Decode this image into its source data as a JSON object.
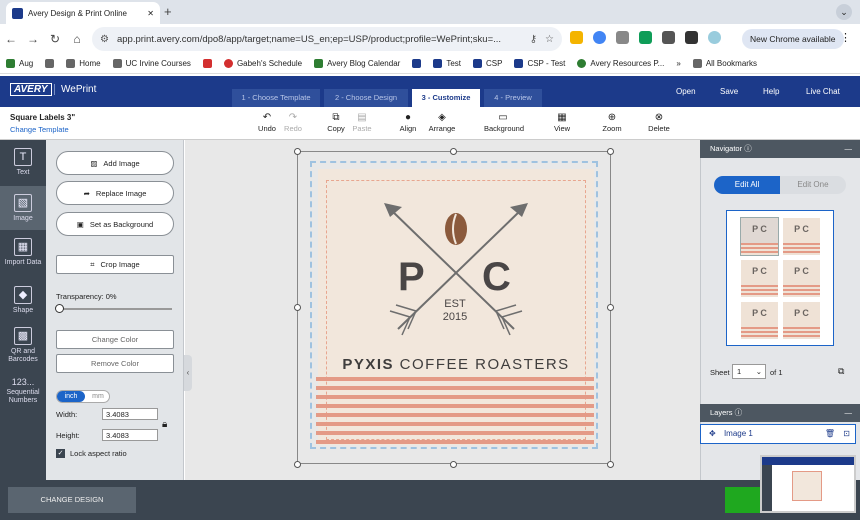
{
  "browser": {
    "tab_title": "Avery Design & Print Online",
    "new_tab": "+",
    "url": "app.print.avery.com/dpo8/app/target;name=US_en;ep=USP/product;profile=WePrint;sku=...",
    "new_chrome": "New Chrome available",
    "bookmarks": [
      {
        "label": "Aug",
        "color": "#2e7d32"
      },
      {
        "label": "",
        "color": "#666666"
      },
      {
        "label": "Home",
        "color": "#666666"
      },
      {
        "label": "UC Irvine Courses",
        "color": "#666666"
      },
      {
        "label": "",
        "color": "#d32f2f"
      },
      {
        "label": "Gabeh's Schedule",
        "color": "#d32f2f"
      },
      {
        "label": "Avery Blog Calendar",
        "color": "#2e7d32"
      },
      {
        "label": "",
        "color": "#1c3a8a"
      },
      {
        "label": "Test",
        "color": "#1c3a8a"
      },
      {
        "label": "CSP",
        "color": "#1c3a8a"
      },
      {
        "label": "CSP - Test",
        "color": "#1c3a8a"
      },
      {
        "label": "Avery Resources P...",
        "color": "#2e7d32"
      }
    ],
    "more_bookmarks": "»",
    "all_bookmarks": "All Bookmarks"
  },
  "app": {
    "logo": "AVERY",
    "product": "WePrint",
    "steps": [
      "1 - Choose Template",
      "2 - Choose Design",
      "3 - Customize",
      "4 - Preview"
    ],
    "active_step": 2,
    "header_links": [
      "Open",
      "Save",
      "Help",
      "Live Chat"
    ]
  },
  "subbar": {
    "title": "Square Labels 3\"",
    "change_template": "Change Template",
    "tools": [
      {
        "label": "Undo",
        "icon": "↶",
        "enabled": true
      },
      {
        "label": "Redo",
        "icon": "↷",
        "enabled": false
      },
      {
        "label": "Copy",
        "icon": "⧉",
        "enabled": true
      },
      {
        "label": "Paste",
        "icon": "📋",
        "enabled": false
      },
      {
        "label": "Align",
        "icon": "●",
        "enabled": true
      },
      {
        "label": "Arrange",
        "icon": "◈",
        "enabled": true
      },
      {
        "label": "Background",
        "icon": "▭",
        "enabled": true
      },
      {
        "label": "View",
        "icon": "▦",
        "enabled": true
      },
      {
        "label": "Zoom",
        "icon": "⊕",
        "enabled": true
      },
      {
        "label": "Delete",
        "icon": "⊗",
        "enabled": true
      }
    ]
  },
  "sidebar": {
    "items": [
      {
        "label": "Text",
        "icon": "T"
      },
      {
        "label": "Image",
        "icon": "▧"
      },
      {
        "label": "Import Data",
        "icon": "▦"
      },
      {
        "label": "Shape",
        "icon": "◆"
      },
      {
        "label": "QR and Barcodes",
        "icon": "▩"
      },
      {
        "label": "Sequential Numbers",
        "icon": "123..."
      }
    ],
    "active": 1
  },
  "panel": {
    "add_image": "Add Image",
    "replace_image": "Replace Image",
    "set_background": "Set as Background",
    "crop_image": "Crop Image",
    "transparency": "Transparency: 0%",
    "change_color": "Change Color",
    "remove_color": "Remove Color",
    "unit_inch": "inch",
    "unit_mm": "mm",
    "width_label": "Width:",
    "width_value": "3.4083",
    "height_label": "Height:",
    "height_value": "3.4083",
    "lock_aspect": "Lock aspect ratio"
  },
  "design": {
    "letter_left": "P",
    "letter_right": "C",
    "est": "EST",
    "year": "2015",
    "brand_bold": "PYXIS",
    "brand_rest": " COFFEE ROASTERS",
    "stripe_color": "#e49a86",
    "bg_color": "#f2e7dc"
  },
  "navigator": {
    "title": "Navigator",
    "edit_all": "Edit All",
    "edit_one": "Edit One",
    "sheet_label": "Sheet",
    "sheet_value": "1",
    "sheet_of": "of 1",
    "mini_text": "P C"
  },
  "layers": {
    "title": "Layers",
    "items": [
      "Image 1"
    ]
  },
  "bottom": {
    "change_design": "CHANGE DESIGN"
  }
}
